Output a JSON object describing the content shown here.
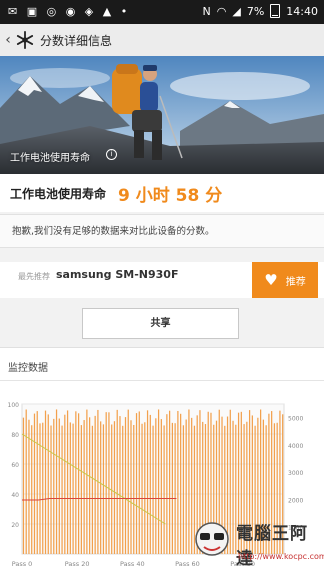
{
  "status_bar": {
    "left_icons": "✉ ▣ ◎ ◉ ◈ ▲ •",
    "carrier": "N",
    "battery_percent": "7%",
    "time": "14:40"
  },
  "app_bar": {
    "back_icon": "chevron-left-icon",
    "logo_icon": "snowflake-icon",
    "title": "分数详细信息"
  },
  "hero": {
    "caption": "工作电池使用寿命",
    "info_icon": "info-icon"
  },
  "score": {
    "label": "工作电池使用寿命",
    "value": "9 小时 58 分",
    "accent": "#f08a1c"
  },
  "notice": {
    "text": "抱歉,我们没有足够的数据来对比此设备的分数。"
  },
  "device": {
    "recommend_prefix": "最先推荐",
    "name": "samsung SM-N930F",
    "recommend_button": "推荐"
  },
  "share_button": "共享",
  "monitor": {
    "title": "监控数据"
  },
  "chart_data": {
    "type": "bar",
    "x_tick_labels": [
      "Pass 0",
      "Pass 20",
      "Pass 40",
      "Pass 60",
      "Pass 80"
    ],
    "x_tick_values": [
      0,
      20,
      40,
      60,
      80
    ],
    "left_axis": {
      "ticks": [
        "100",
        "80",
        "60",
        "40",
        "20"
      ],
      "ylim": [
        0,
        100
      ]
    },
    "right_axis": {
      "ticks": [
        "5000",
        "4000",
        "3000",
        "2000",
        "1000"
      ],
      "ylim": [
        0,
        5500
      ]
    },
    "series": [
      {
        "type": "bar",
        "axis": "right",
        "color": "#f2a04c",
        "count": 95,
        "value_range": [
          4700,
          5300
        ]
      },
      {
        "type": "line",
        "axis": "left",
        "color": "#c8c84a",
        "points": [
          [
            0,
            80
          ],
          [
            52,
            20
          ]
        ]
      },
      {
        "type": "line",
        "axis": "left",
        "color": "#d9453b",
        "points": [
          [
            0,
            36
          ],
          [
            6,
            36
          ],
          [
            10,
            37
          ],
          [
            56,
            37
          ]
        ]
      }
    ],
    "grid": true
  },
  "watermark": {
    "text": "電腦王阿達",
    "url": "http://www.kocpc.com.tw"
  }
}
